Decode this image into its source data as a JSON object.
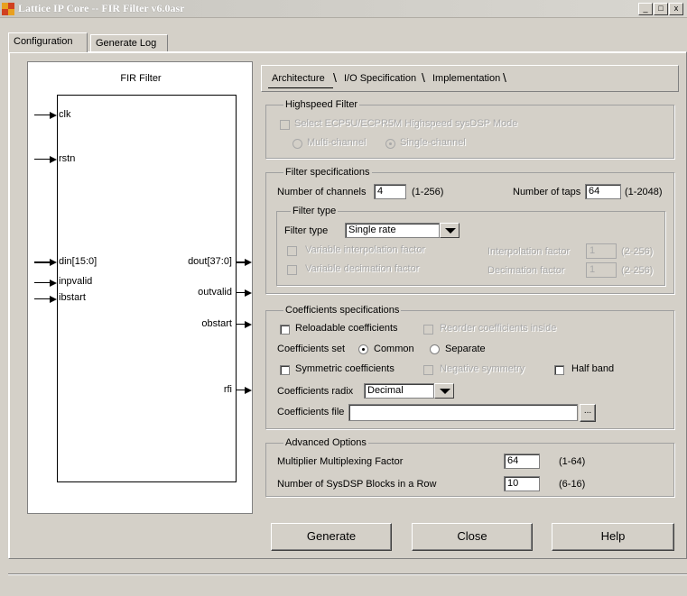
{
  "window": {
    "title": "Lattice IP Core -- FIR Filter v6.0asr",
    "controls": [
      "_",
      "□",
      "x"
    ]
  },
  "main_tabs": [
    {
      "label": "Configuration",
      "active": true
    },
    {
      "label": "Generate Log",
      "active": false
    }
  ],
  "diagram": {
    "title": "FIR Filter",
    "inputs": [
      "clk",
      "rstn",
      "din[15:0]",
      "inpvalid",
      "ibstart"
    ],
    "outputs": [
      "dout[37:0]",
      "outvalid",
      "obstart",
      "rfi"
    ]
  },
  "sub_tabs": [
    {
      "label": "Architecture",
      "active": true
    },
    {
      "label": "I/O Specification",
      "active": false
    },
    {
      "label": "Implementation",
      "active": false
    }
  ],
  "highspeed": {
    "legend": "Highspeed Filter",
    "select_label": "Select ECP5U/ECPR5M Highspeed sysDSP Mode",
    "multi_label": "Multi-channel",
    "single_label": "Single-channel",
    "single_selected": true
  },
  "filter_spec": {
    "legend": "Filter specifications",
    "channels_label": "Number of channels",
    "channels_value": "4",
    "channels_range": "(1-256)",
    "taps_label": "Number of taps",
    "taps_value": "64",
    "taps_range": "(1-2048)",
    "filter_type": {
      "legend": "Filter type",
      "label": "Filter type",
      "value": "Single rate",
      "var_interp_label": "Variable interpolation factor",
      "interp_label": "Interpolation factor",
      "interp_value": "1",
      "interp_range": "(2-256)",
      "var_decim_label": "Variable decimation factor",
      "decim_label": "Decimation factor",
      "decim_value": "1",
      "decim_range": "(2-256)"
    }
  },
  "coeff_spec": {
    "legend": "Coefficients specifications",
    "reloadable_label": "Reloadable coefficients",
    "reorder_label": "Reorder coefficients inside",
    "set_label": "Coefficients set",
    "common_label": "Common",
    "separate_label": "Separate",
    "common_selected": true,
    "symmetric_label": "Symmetric coefficients",
    "negative_label": "Negative symmetry",
    "halfband_label": "Half band",
    "radix_label": "Coefficients radix",
    "radix_value": "Decimal",
    "file_label": "Coefficients file",
    "file_value": "",
    "browse_label": "..."
  },
  "advanced": {
    "legend": "Advanced Options",
    "mult_label": "Multiplier Multiplexing Factor",
    "mult_value": "64",
    "mult_range": "(1-64)",
    "blocks_label": "Number of SysDSP Blocks in a Row",
    "blocks_value": "10",
    "blocks_range": "(6-16)"
  },
  "buttons": {
    "generate": "Generate",
    "close": "Close",
    "help": "Help"
  }
}
